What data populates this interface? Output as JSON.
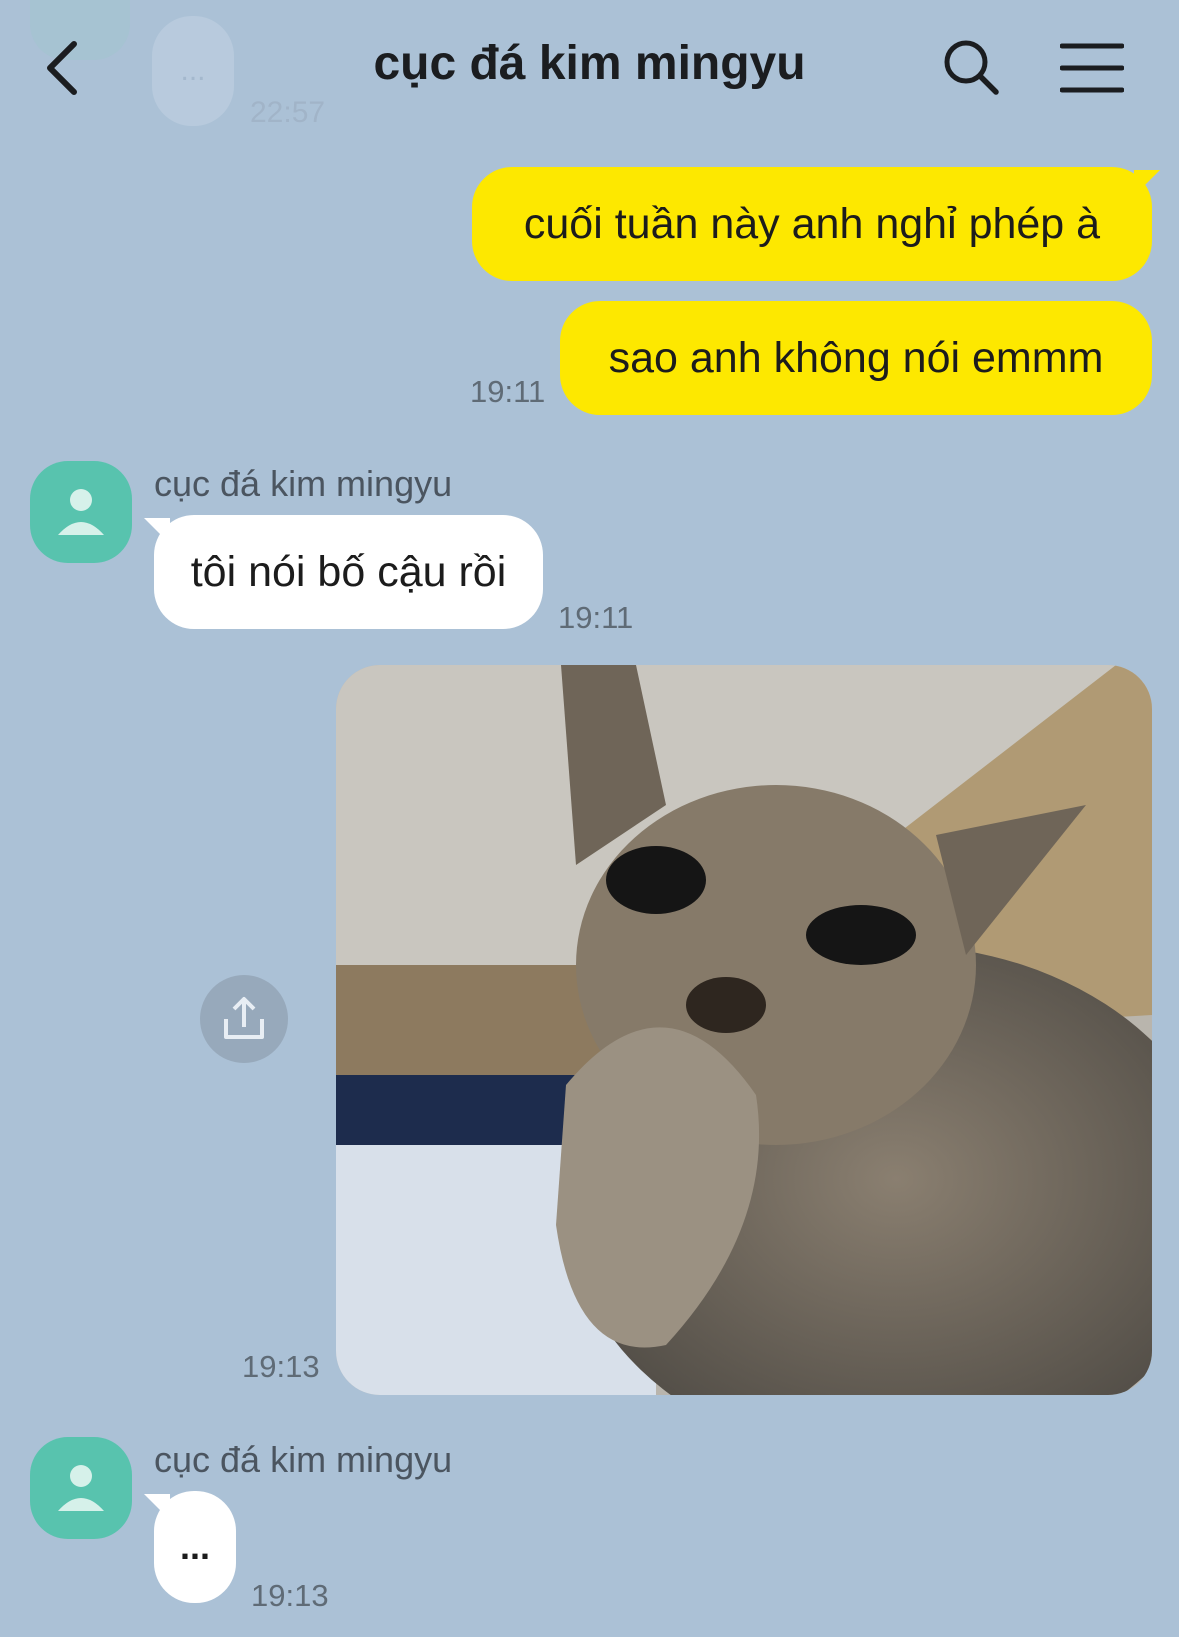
{
  "header": {
    "title": "cục đá kim mingyu",
    "back_icon": "chevron-left-icon",
    "search_icon": "search-icon",
    "menu_icon": "menu-icon"
  },
  "previous": {
    "bubble_text": "...",
    "time": "22:57"
  },
  "messages": [
    {
      "from": "me",
      "text": "cuối tuần này anh nghỉ phép à"
    },
    {
      "from": "me",
      "text": "sao anh không nói emmm",
      "time": "19:11"
    },
    {
      "from": "other",
      "sender": "cục đá kim mingyu",
      "text": "tôi nói bố cậu rồi",
      "time": "19:11"
    },
    {
      "from": "me",
      "type": "image",
      "time": "19:13",
      "share_icon": "share-icon"
    },
    {
      "from": "other",
      "sender": "cục đá kim mingyu",
      "text": "...",
      "time": "19:13"
    }
  ],
  "colors": {
    "background": "#abc1d6",
    "outgoing_bubble": "#fde800",
    "incoming_bubble": "#ffffff",
    "avatar": "#58c3ae"
  }
}
